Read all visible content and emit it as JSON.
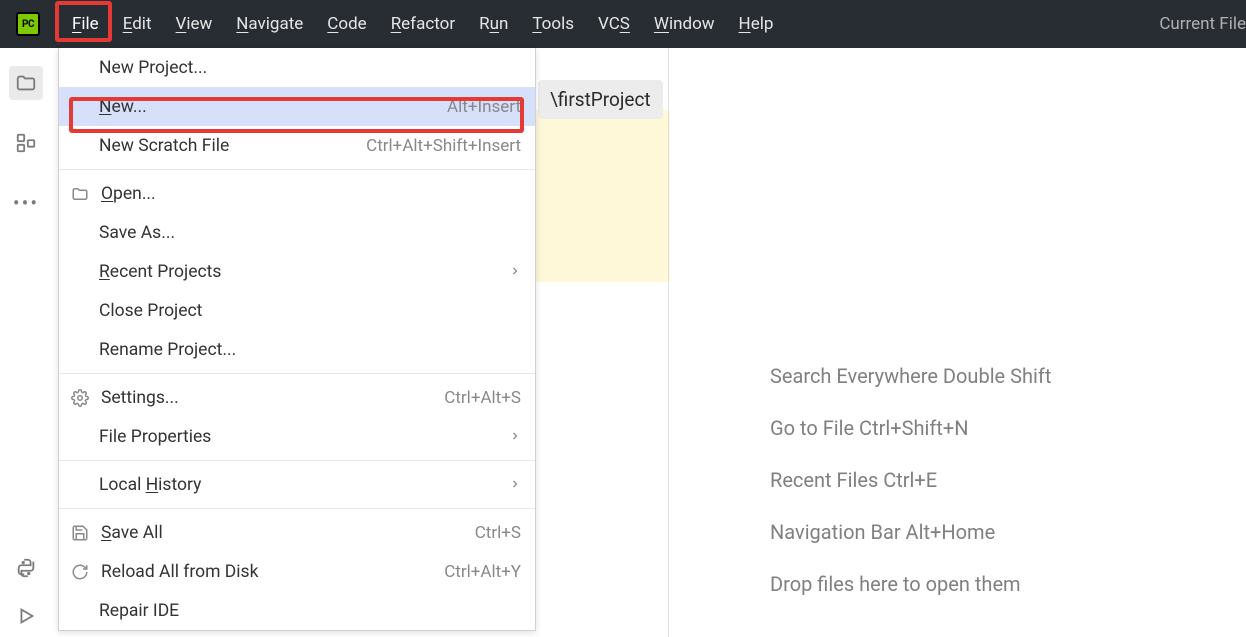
{
  "menubar": {
    "logo_text": "PC",
    "items": [
      {
        "label": "File",
        "mn": "F"
      },
      {
        "label": "Edit",
        "mn": "E"
      },
      {
        "label": "View",
        "mn": "V"
      },
      {
        "label": "Navigate",
        "mn": "N"
      },
      {
        "label": "Code",
        "mn": "C"
      },
      {
        "label": "Refactor",
        "mn": "R"
      },
      {
        "label": "Run",
        "mn": ""
      },
      {
        "label": "Tools",
        "mn": "T"
      },
      {
        "label": "VCS",
        "mn": ""
      },
      {
        "label": "Window",
        "mn": "W"
      },
      {
        "label": "Help",
        "mn": "H"
      }
    ],
    "status_right": "Current File"
  },
  "dropdown": {
    "groups": [
      [
        {
          "label": "New Project...",
          "icon": "",
          "shortcut": "",
          "mn": ""
        },
        {
          "label": "New...",
          "icon": "",
          "shortcut": "Alt+Insert",
          "mn": "N",
          "highlight": true
        },
        {
          "label": "New Scratch File",
          "icon": "",
          "shortcut": "Ctrl+Alt+Shift+Insert",
          "mn": ""
        }
      ],
      [
        {
          "label": "Open...",
          "icon": "folder",
          "shortcut": "",
          "mn": "O"
        },
        {
          "label": "Save As...",
          "icon": "",
          "shortcut": "",
          "mn": ""
        },
        {
          "label": "Recent Projects",
          "icon": "",
          "shortcut": "",
          "arrow": true,
          "mn": "R"
        },
        {
          "label": "Close Project",
          "icon": "",
          "shortcut": "",
          "mn": ""
        },
        {
          "label": "Rename Project...",
          "icon": "",
          "shortcut": "",
          "mn": ""
        }
      ],
      [
        {
          "label": "Settings...",
          "icon": "gear",
          "shortcut": "Ctrl+Alt+S",
          "mn": ""
        },
        {
          "label": "File Properties",
          "icon": "",
          "shortcut": "",
          "arrow": true,
          "mn": ""
        }
      ],
      [
        {
          "label": "Local History",
          "icon": "",
          "shortcut": "",
          "arrow": true,
          "mn": "H"
        }
      ],
      [
        {
          "label": "Save All",
          "icon": "save",
          "shortcut": "Ctrl+S",
          "mn": "S"
        },
        {
          "label": "Reload All from Disk",
          "icon": "reload",
          "shortcut": "Ctrl+Alt+Y",
          "mn": ""
        },
        {
          "label": "Repair IDE",
          "icon": "",
          "shortcut": "",
          "mn": ""
        }
      ]
    ]
  },
  "path_chip": "\\firstProject",
  "welcome": {
    "lines": [
      "Search Everywhere Double Shift",
      "Go to File Ctrl+Shift+N",
      "Recent Files Ctrl+E",
      "Navigation Bar Alt+Home",
      "Drop files here to open them"
    ]
  }
}
